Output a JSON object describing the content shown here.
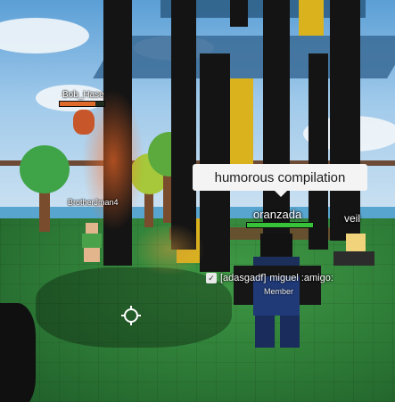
{
  "speech_bubble": {
    "text": "humorous compilation"
  },
  "players": {
    "main": {
      "name": "oranzada",
      "health": 1.0
    },
    "flying": {
      "name": "Bob_Hase",
      "health": 0.8
    },
    "left": {
      "name": "BrotherJman4"
    },
    "right": {
      "name": "veil"
    }
  },
  "chat": {
    "badge_icon": "shield-check-icon",
    "tag": "[adasgadf]",
    "message": "miguel :amigo:",
    "rank": "Member"
  },
  "colors": {
    "grass": "#2d7a36",
    "pillar": "#141414",
    "gold": "#d9b21e",
    "health_green": "#38c23a"
  }
}
